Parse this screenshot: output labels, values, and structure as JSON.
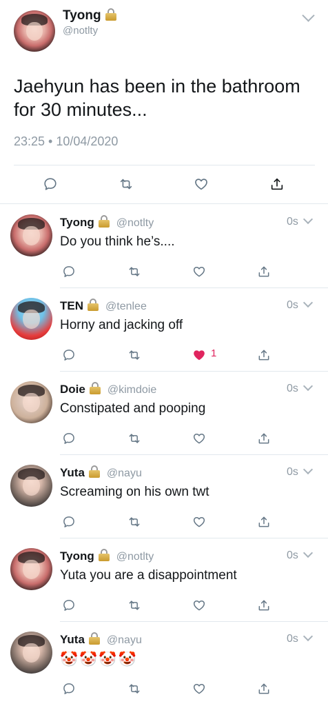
{
  "main_tweet": {
    "name": "Tyong",
    "handle": "@notlty",
    "text": "Jaehyun has been in the bathroom for 30 minutes...",
    "timestamp": "23:25 • 10/04/2020",
    "actions": [
      "reply-icon",
      "retweet-icon",
      "like-icon",
      "share-icon"
    ]
  },
  "replies": [
    {
      "name": "Tyong",
      "handle": "@notlty",
      "time": "0s",
      "text": "Do you think he’s....",
      "liked": false,
      "like_count": ""
    },
    {
      "name": "TEN",
      "handle": "@tenlee",
      "time": "0s",
      "text": "Horny and jacking off",
      "liked": true,
      "like_count": "1"
    },
    {
      "name": "Doie",
      "handle": "@kimdoie",
      "time": "0s",
      "text": "Constipated and pooping",
      "liked": false,
      "like_count": ""
    },
    {
      "name": "Yuta",
      "handle": "@nayu",
      "time": "0s",
      "text": "Screaming on his own twt",
      "liked": false,
      "like_count": ""
    },
    {
      "name": "Tyong",
      "handle": "@notlty",
      "time": "0s",
      "text": "Yuta you are a disappointment",
      "liked": false,
      "like_count": ""
    },
    {
      "name": "Yuta",
      "handle": "@nayu",
      "time": "0s",
      "text": "🤡🤡🤡🤡",
      "liked": false,
      "like_count": ""
    }
  ],
  "colors": {
    "text": "#14171a",
    "secondary": "#8e99a3",
    "icon": "#657786",
    "like_red": "#e0245e",
    "divider": "#e1e8ed"
  }
}
